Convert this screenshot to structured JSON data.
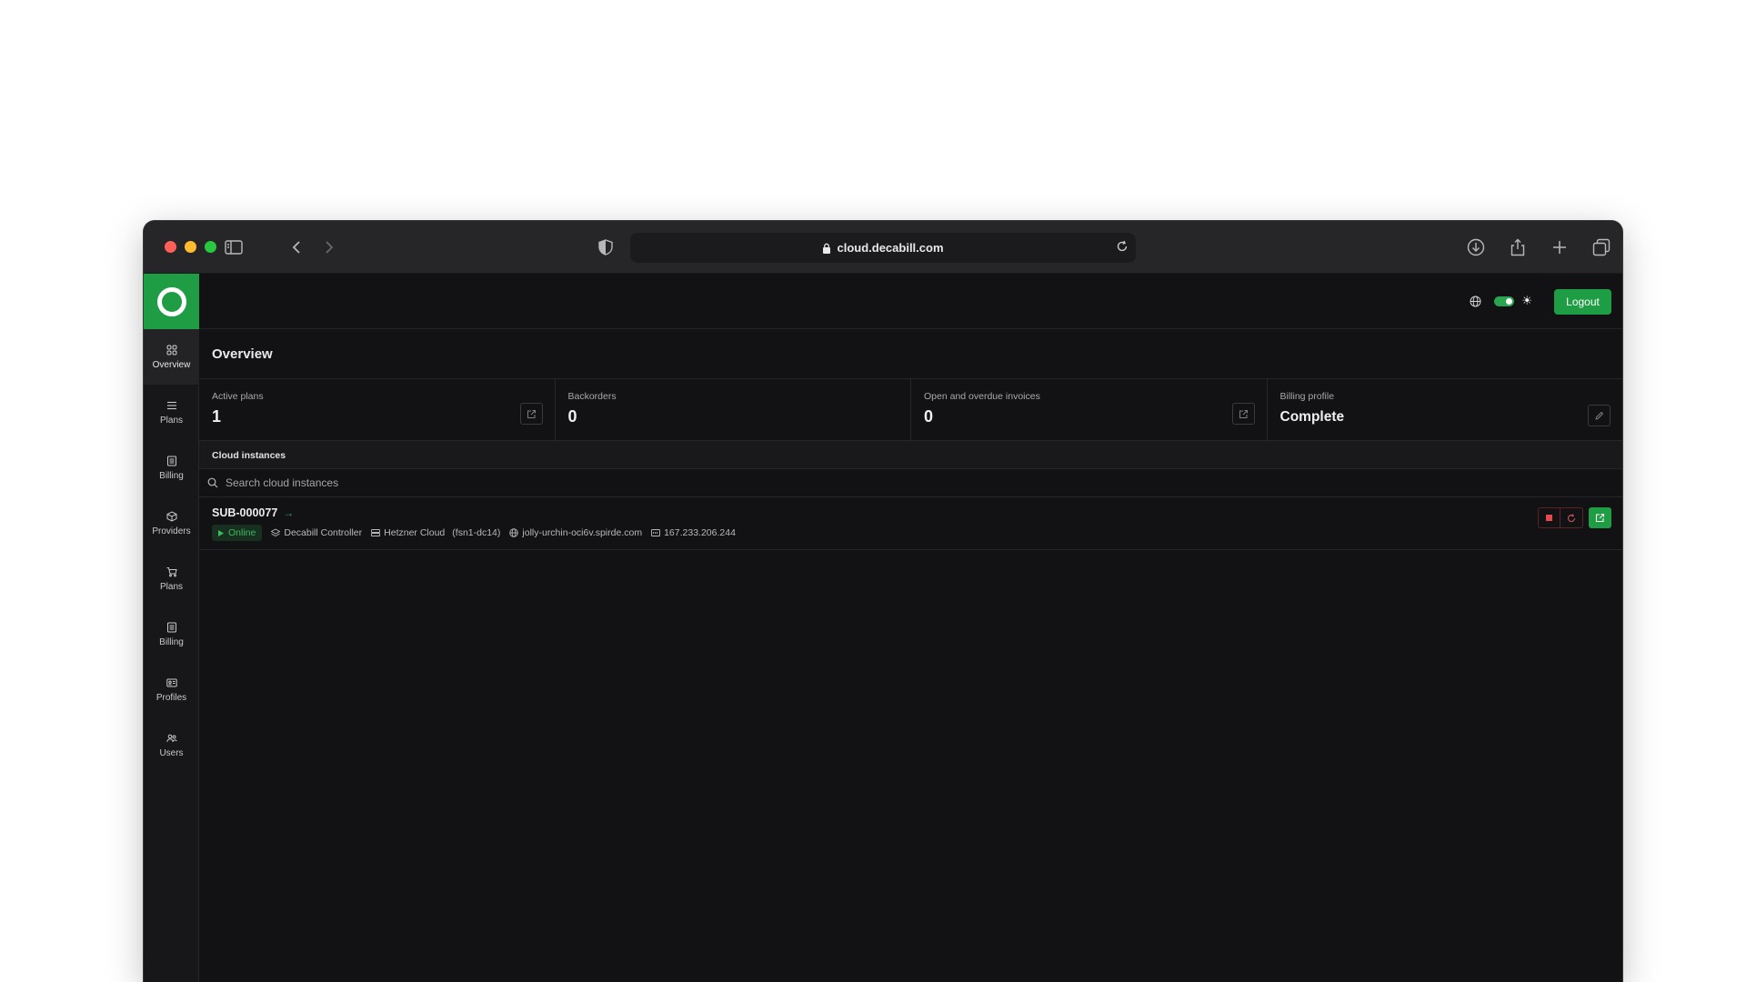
{
  "browser": {
    "url": "cloud.decabill.com"
  },
  "sidebar": {
    "items": [
      {
        "label": "Overview",
        "icon": "grid-icon"
      },
      {
        "label": "Plans",
        "icon": "list-icon"
      },
      {
        "label": "Billing",
        "icon": "receipt-icon"
      },
      {
        "label": "Providers",
        "icon": "box-icon"
      },
      {
        "label": "Plans",
        "icon": "cart-icon"
      },
      {
        "label": "Billing",
        "icon": "receipt-icon"
      },
      {
        "label": "Profiles",
        "icon": "id-card-icon"
      },
      {
        "label": "Users",
        "icon": "users-icon"
      }
    ]
  },
  "topbar": {
    "logout_label": "Logout"
  },
  "main": {
    "title": "Overview",
    "stats": [
      {
        "label": "Active plans",
        "value": "1"
      },
      {
        "label": "Backorders",
        "value": "0"
      },
      {
        "label": "Open and overdue invoices",
        "value": "0"
      },
      {
        "label": "Billing profile",
        "value": "Complete"
      }
    ],
    "section_title": "Cloud instances",
    "search_placeholder": "Search cloud instances",
    "instance": {
      "id": "SUB-000077",
      "status": "Online",
      "controller": "Decabill Controller",
      "provider": "Hetzner Cloud",
      "location": "(fsn1-dc14)",
      "hostname": "jolly-urchin-oci6v.spirde.com",
      "ip": "167.233.206.244"
    }
  },
  "colors": {
    "accent": "#1f9d45",
    "danger": "#e5484d",
    "background": "#121214"
  }
}
